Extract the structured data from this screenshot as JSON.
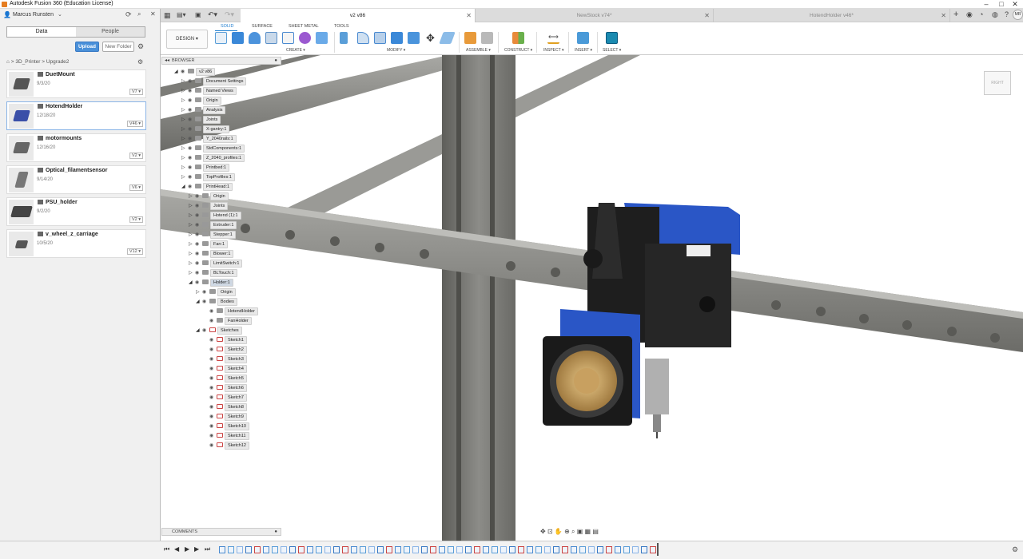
{
  "app": {
    "title": "Autodesk Fusion 360 (Education License)"
  },
  "window_controls": [
    "–",
    "□",
    "✕"
  ],
  "user": {
    "name": "Marcus Runsten"
  },
  "data_panel": {
    "tabs": [
      {
        "label": "Data",
        "active": true
      },
      {
        "label": "People",
        "active": false
      }
    ],
    "upload_label": "Upload",
    "new_folder_label": "New Folder",
    "breadcrumb": [
      "3D_Printer",
      "Upgrade2"
    ],
    "files": [
      {
        "name": "DuetMount",
        "date": "9/3/20",
        "version": "V7"
      },
      {
        "name": "HotendHolder",
        "date": "12/18/20",
        "version": "V46",
        "selected": true
      },
      {
        "name": "motormounts",
        "date": "12/16/20",
        "version": "V2"
      },
      {
        "name": "Optical_filamentsensor",
        "date": "9/14/20",
        "version": "V6"
      },
      {
        "name": "PSU_holder",
        "date": "9/2/20",
        "version": "V2"
      },
      {
        "name": "v_wheel_z_carriage",
        "date": "10/5/20",
        "version": "V12"
      }
    ]
  },
  "doc_tabs": [
    {
      "label": "v2 v86",
      "active": true
    },
    {
      "label": "NewStock v74*",
      "active": false
    },
    {
      "label": "HotendHolder v46*",
      "active": false
    }
  ],
  "toolbar": {
    "design_label": "DESIGN",
    "tabs": [
      {
        "label": "SOLID",
        "active": true
      },
      {
        "label": "SURFACE",
        "active": false
      },
      {
        "label": "SHEET METAL",
        "active": false
      },
      {
        "label": "TOOLS",
        "active": false
      }
    ],
    "groups": [
      "CREATE",
      "MODIFY",
      "ASSEMBLE",
      "CONSTRUCT",
      "INSPECT",
      "INSERT",
      "SELECT"
    ]
  },
  "browser": {
    "title": "BROWSER",
    "nodes": [
      {
        "label": "v2 v86",
        "depth": 0
      },
      {
        "label": "Document Settings",
        "depth": 1
      },
      {
        "label": "Named Views",
        "depth": 1
      },
      {
        "label": "Origin",
        "depth": 1
      },
      {
        "label": "Analysis",
        "depth": 1
      },
      {
        "label": "Joints",
        "depth": 1
      },
      {
        "label": "X-gantry:1",
        "depth": 1
      },
      {
        "label": "Y_2040rails:1",
        "depth": 1
      },
      {
        "label": "StdComponents:1",
        "depth": 1
      },
      {
        "label": "Z_2040_profiles:1",
        "depth": 1
      },
      {
        "label": "Printbed:1",
        "depth": 1
      },
      {
        "label": "TopProfiles:1",
        "depth": 1
      },
      {
        "label": "PrintHead:1",
        "depth": 1
      },
      {
        "label": "Origin",
        "depth": 2
      },
      {
        "label": "Joints",
        "depth": 2
      },
      {
        "label": "Hotend (1):1",
        "depth": 2
      },
      {
        "label": "Extruder:1",
        "depth": 2
      },
      {
        "label": "Stepper:1",
        "depth": 2
      },
      {
        "label": "Fan:1",
        "depth": 2
      },
      {
        "label": "Blower:1",
        "depth": 2
      },
      {
        "label": "LimitSwitch:1",
        "depth": 2
      },
      {
        "label": "BLTouch:1",
        "depth": 2
      },
      {
        "label": "Holder:1",
        "depth": 2
      },
      {
        "label": "Origin",
        "depth": 3
      },
      {
        "label": "Bodies",
        "depth": 3
      },
      {
        "label": "HotendHolder",
        "depth": 4
      },
      {
        "label": "FanHolder",
        "depth": 4
      },
      {
        "label": "Sketches",
        "depth": 3
      },
      {
        "label": "Sketch1",
        "depth": 4
      },
      {
        "label": "Sketch2",
        "depth": 4
      },
      {
        "label": "Sketch3",
        "depth": 4
      },
      {
        "label": "Sketch4",
        "depth": 4
      },
      {
        "label": "Sketch5",
        "depth": 4
      },
      {
        "label": "Sketch6",
        "depth": 4
      },
      {
        "label": "Sketch7",
        "depth": 4
      },
      {
        "label": "Sketch8",
        "depth": 4
      },
      {
        "label": "Sketch9",
        "depth": 4
      },
      {
        "label": "Sketch10",
        "depth": 4
      },
      {
        "label": "Sketch11",
        "depth": 4
      },
      {
        "label": "Sketch12",
        "depth": 4
      }
    ]
  },
  "viewcube": {
    "label": "RIGHT"
  },
  "comments": {
    "title": "COMMENTS"
  },
  "colors": {
    "accent": "#1e7ed0",
    "upload": "#4a90d9",
    "extrusion": "#8a8a86",
    "holder_blue": "#2a56c6"
  }
}
